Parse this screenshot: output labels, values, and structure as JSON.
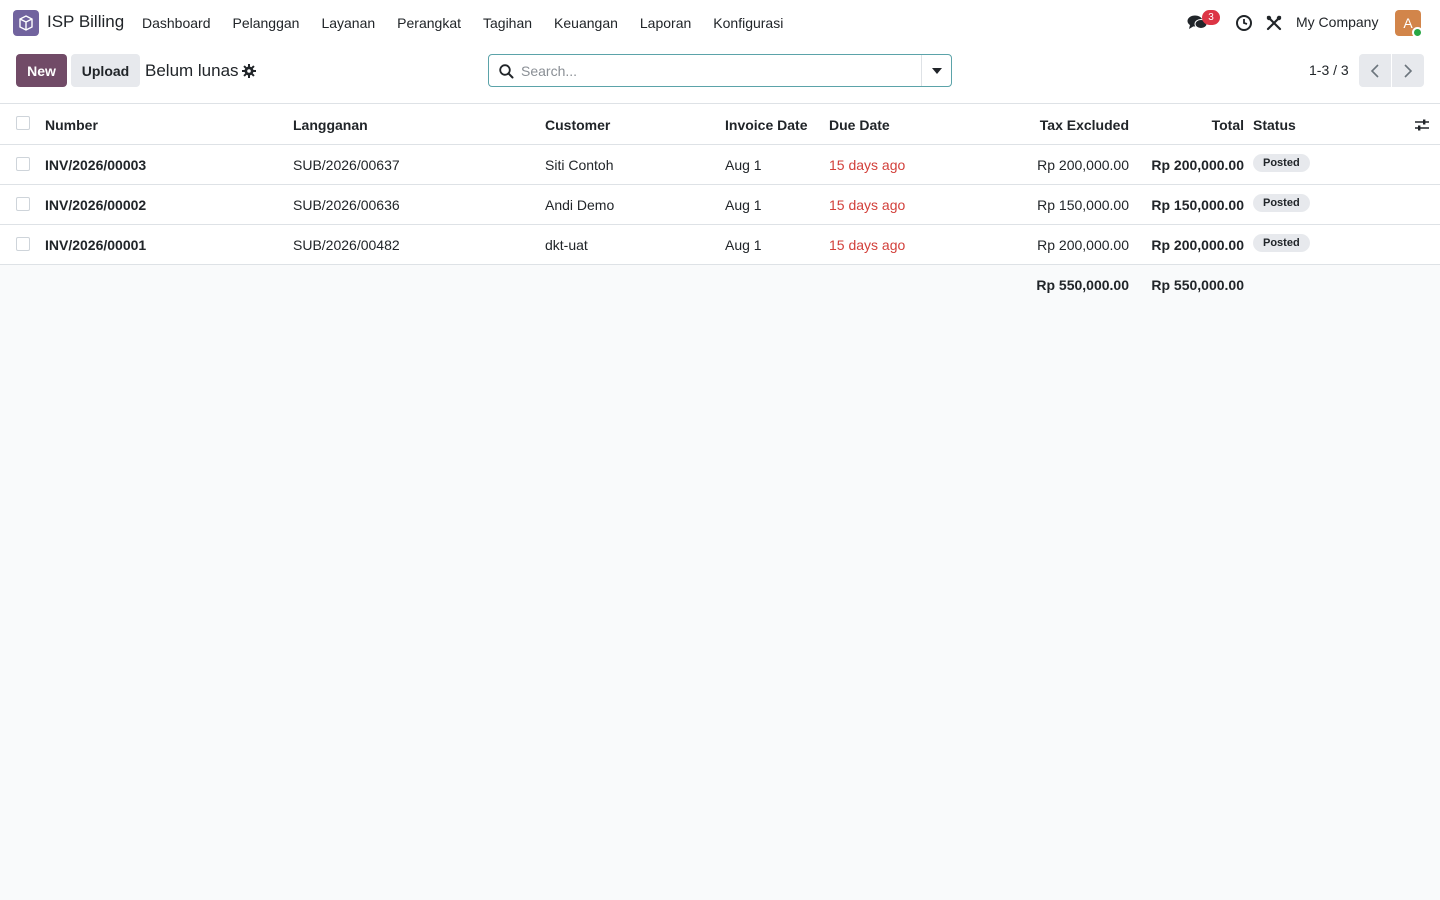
{
  "navbar": {
    "app_name": "ISP Billing",
    "menu": [
      "Dashboard",
      "Pelanggan",
      "Layanan",
      "Perangkat",
      "Tagihan",
      "Keuangan",
      "Laporan",
      "Konfigurasi"
    ],
    "chat_count": "3",
    "company": "My Company",
    "avatar_letter": "A"
  },
  "control": {
    "new_label": "New",
    "upload_label": "Upload",
    "title": "Belum lunas",
    "search_placeholder": "Search...",
    "pager": "1-3 / 3"
  },
  "table": {
    "columns": {
      "number": "Number",
      "subscription": "Langganan",
      "customer": "Customer",
      "invoice_date": "Invoice Date",
      "due_date": "Due Date",
      "tax_excluded": "Tax Excluded",
      "total": "Total",
      "status": "Status"
    },
    "rows": [
      {
        "number": "INV/2026/00003",
        "subscription": "SUB/2026/00637",
        "customer": "Siti Contoh",
        "invoice_date": "Aug 1",
        "due_date": "15 days ago",
        "tax_excluded": "Rp 200,000.00",
        "total": "Rp 200,000.00",
        "status": "Posted"
      },
      {
        "number": "INV/2026/00002",
        "subscription": "SUB/2026/00636",
        "customer": "Andi Demo",
        "invoice_date": "Aug 1",
        "due_date": "15 days ago",
        "tax_excluded": "Rp 150,000.00",
        "total": "Rp 150,000.00",
        "status": "Posted"
      },
      {
        "number": "INV/2026/00001",
        "subscription": "SUB/2026/00482",
        "customer": "dkt-uat",
        "invoice_date": "Aug 1",
        "due_date": "15 days ago",
        "tax_excluded": "Rp 200,000.00",
        "total": "Rp 200,000.00",
        "status": "Posted"
      }
    ],
    "totals": {
      "tax_excluded": "Rp 550,000.00",
      "total": "Rp 550,000.00"
    }
  },
  "colors": {
    "brand": "#714b67",
    "overdue": "#d23f3a",
    "app_icon": "#71639e"
  }
}
